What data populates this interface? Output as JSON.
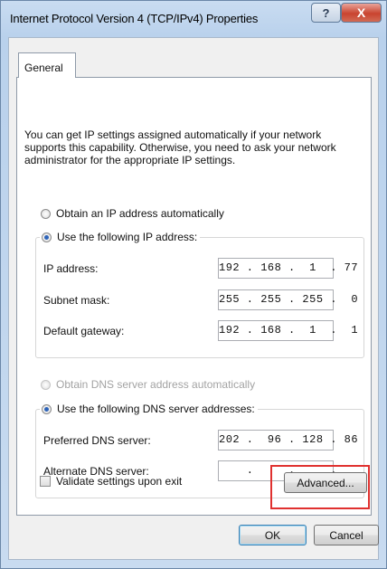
{
  "window": {
    "title": "Internet Protocol Version 4 (TCP/IPv4) Properties",
    "help_label": "?",
    "close_label": "X"
  },
  "tabs": [
    {
      "label": "General"
    }
  ],
  "intro_text": "You can get IP settings assigned automatically if your network supports this capability. Otherwise, you need to ask your network administrator for the appropriate IP settings.",
  "ip_section": {
    "auto_label": "Obtain an IP address automatically",
    "manual_label": "Use the following IP address:",
    "selected": "manual",
    "fields": [
      {
        "label": "IP address:",
        "value": "192 . 168 .  1  . 77"
      },
      {
        "label": "Subnet mask:",
        "value": "255 . 255 . 255 .  0"
      },
      {
        "label": "Default gateway:",
        "value": "192 . 168 .  1  .  1"
      }
    ]
  },
  "dns_section": {
    "auto_label": "Obtain DNS server address automatically",
    "manual_label": "Use the following DNS server addresses:",
    "selected": "manual",
    "fields": [
      {
        "label": "Preferred DNS server:",
        "value": "202 .  96 . 128 . 86"
      },
      {
        "label": "Alternate DNS server:",
        "value": "    .     .     .   "
      }
    ]
  },
  "validate_label": "Validate settings upon exit",
  "validate_checked": false,
  "buttons": {
    "advanced": "Advanced...",
    "ok": "OK",
    "cancel": "Cancel"
  },
  "colors": {
    "highlight": "#e0312f",
    "radio_selected": "#2d63b8"
  }
}
